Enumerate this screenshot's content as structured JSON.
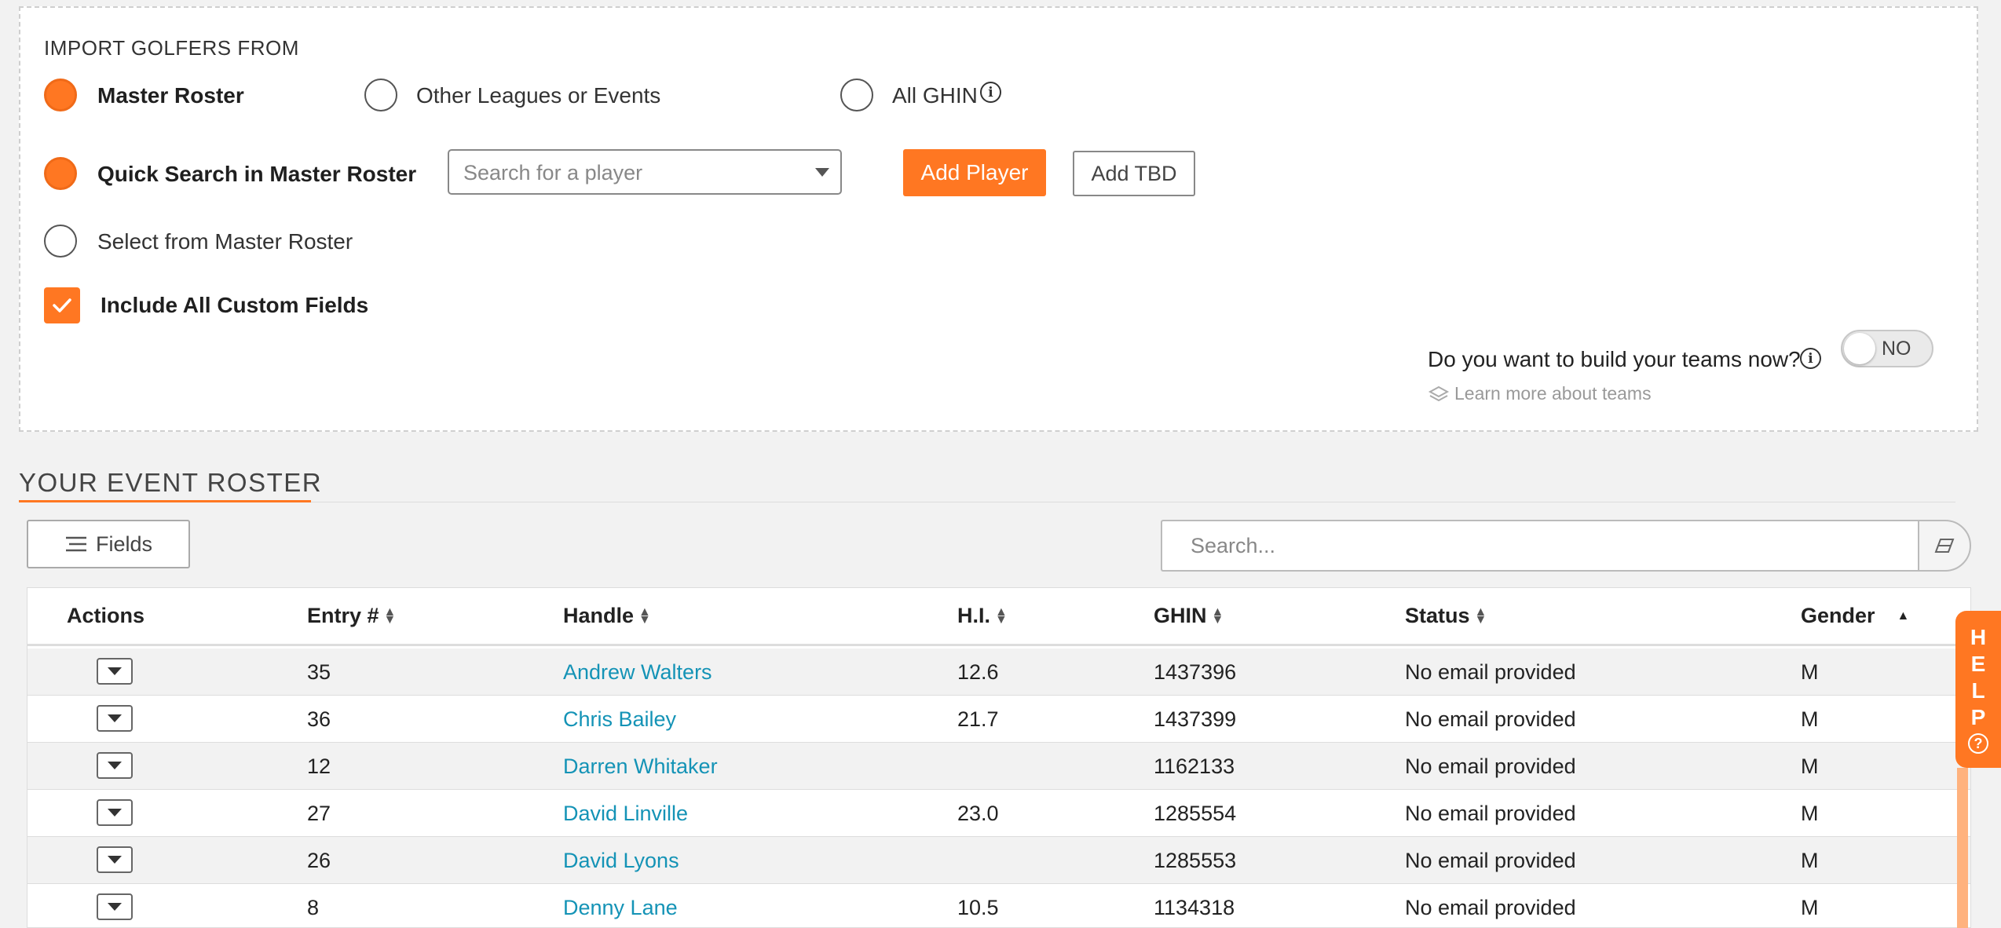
{
  "import": {
    "title": "IMPORT GOLFERS FROM",
    "sources": [
      {
        "label": "Master Roster",
        "selected": true
      },
      {
        "label": "Other Leagues or Events",
        "selected": false
      },
      {
        "label": "All GHIN",
        "selected": false
      }
    ],
    "quick_search_label": "Quick Search in Master Roster",
    "search_placeholder": "Search for a player",
    "add_player": "Add Player",
    "add_tbd": "Add TBD",
    "select_label": "Select from Master Roster",
    "custom_fields_label": "Include All Custom Fields",
    "teams_question": "Do you want to build your teams now?",
    "teams_toggle": "NO",
    "learn_more": "Learn more about teams"
  },
  "roster": {
    "title": "YOUR EVENT ROSTER",
    "fields_button": "Fields",
    "search_placeholder": "Search...",
    "columns": [
      "Actions",
      "Entry #",
      "Handle",
      "H.I.",
      "GHIN",
      "Status",
      "Gender"
    ],
    "rows": [
      {
        "entry": "35",
        "handle": "Andrew Walters",
        "hi": "12.6",
        "ghin": "1437396",
        "status": "No email provided",
        "gender": "M"
      },
      {
        "entry": "36",
        "handle": "Chris Bailey",
        "hi": "21.7",
        "ghin": "1437399",
        "status": "No email provided",
        "gender": "M"
      },
      {
        "entry": "12",
        "handle": "Darren Whitaker",
        "hi": "",
        "ghin": "1162133",
        "status": "No email provided",
        "gender": "M"
      },
      {
        "entry": "27",
        "handle": "David Linville",
        "hi": "23.0",
        "ghin": "1285554",
        "status": "No email provided",
        "gender": "M"
      },
      {
        "entry": "26",
        "handle": "David Lyons",
        "hi": "",
        "ghin": "1285553",
        "status": "No email provided",
        "gender": "M"
      },
      {
        "entry": "8",
        "handle": "Denny Lane",
        "hi": "10.5",
        "ghin": "1134318",
        "status": "No email provided",
        "gender": "M"
      }
    ]
  },
  "help": {
    "letters": [
      "H",
      "E",
      "L",
      "P"
    ]
  },
  "colors": {
    "accent": "#ff7722",
    "link": "#1493b6"
  }
}
